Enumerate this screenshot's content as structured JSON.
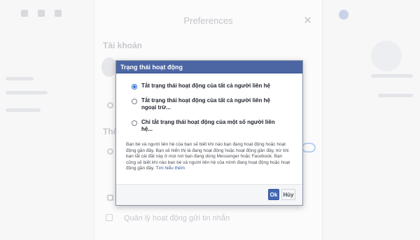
{
  "preferences": {
    "title": "Preferences",
    "close_glyph": "✕",
    "section_account": "Tài khoản",
    "section_notifications": "Thô",
    "row_message_activity": "Quản lý hoạt động gửi tin nhắn"
  },
  "dialog": {
    "title": "Trạng thái hoạt động",
    "options": [
      {
        "label": "Tắt trạng thái hoạt động của tất cả người liên hệ",
        "selected": true
      },
      {
        "label": "Tắt trạng thái hoạt động của tất cả người liên hệ ngoại trừ...",
        "selected": false
      },
      {
        "label": "Chỉ tắt trạng thái hoạt động của một số người liên hệ...",
        "selected": false
      }
    ],
    "description": "Bạn bè và người liên hệ của bạn sẽ biết khi nào bạn đang hoạt động hoặc hoạt động gần đây. Bạn sẽ hiển thị là đang hoạt động hoặc hoạt động gần đây, trừ khi bạn tắt cài đặt này ở mọi nơi bạn đang dùng Messenger hoặc Facebook. Bạn cũng sẽ biết khi nào bạn bè và người liên hệ của mình đang hoạt động hoặc hoạt động gần đây.",
    "learn_more": "Tìm hiểu thêm",
    "ok_label": "Ok",
    "cancel_label": "Hủy"
  },
  "colors": {
    "header_bg": "#4c66a4",
    "primary_button": "#4267b2",
    "link": "#365899"
  }
}
